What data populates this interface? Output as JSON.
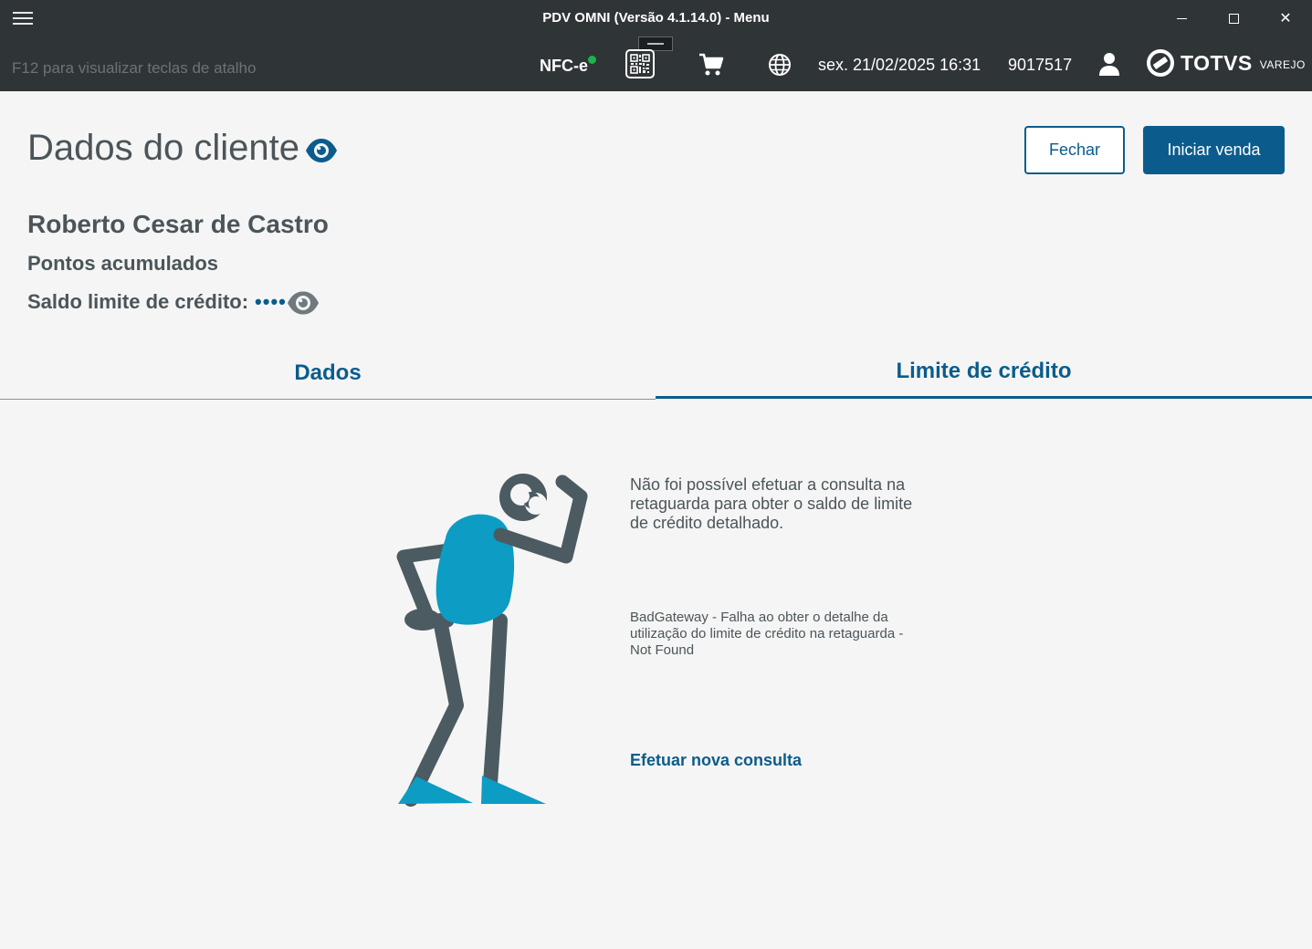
{
  "window": {
    "title": "PDV OMNI (Versão 4.1.14.0) - Menu",
    "menu_icon": "hamburger-icon",
    "minimize_icon": "minimize-icon",
    "maximize_icon": "maximize-icon",
    "close_icon": "close-icon",
    "close_glyph": "✕"
  },
  "header": {
    "hint": "F12 para visualizar teclas de atalho",
    "nfce_label": "NFC-e",
    "nfce_status_color": "#1bb34a",
    "datetime": "sex. 21/02/2025 16:31",
    "operator_code": "9017517",
    "logo_text": "TOTVS",
    "logo_subtext": "VAREJO",
    "icons": [
      "qr-code-icon",
      "cart-icon",
      "globe-icon",
      "user-icon"
    ]
  },
  "page": {
    "title": "Dados do cliente",
    "buttons": {
      "close": "Fechar",
      "start_sale": "Iniciar venda"
    }
  },
  "customer": {
    "name": "Roberto Cesar de Castro",
    "points_label": "Pontos acumulados",
    "credit_label": "Saldo limite de crédito:",
    "credit_mask": "••••"
  },
  "tabs": [
    {
      "label": "Dados",
      "active": false
    },
    {
      "label": "Limite de crédito",
      "active": true
    }
  ],
  "error": {
    "message": "Não foi possível efetuar a consulta na retaguarda para obter o saldo de limite de crédito detalhado.",
    "detail": "BadGateway - Falha ao obter o detalhe da utilização do limite de crédito na retaguarda - Not Found",
    "retry_link": "Efetuar nova consulta"
  },
  "colors": {
    "header_bg": "#2f3437",
    "primary": "#0b5c8c",
    "text": "#4b5559",
    "illustration_body": "#0d9cc4",
    "illustration_limbs": "#4b5b61"
  }
}
